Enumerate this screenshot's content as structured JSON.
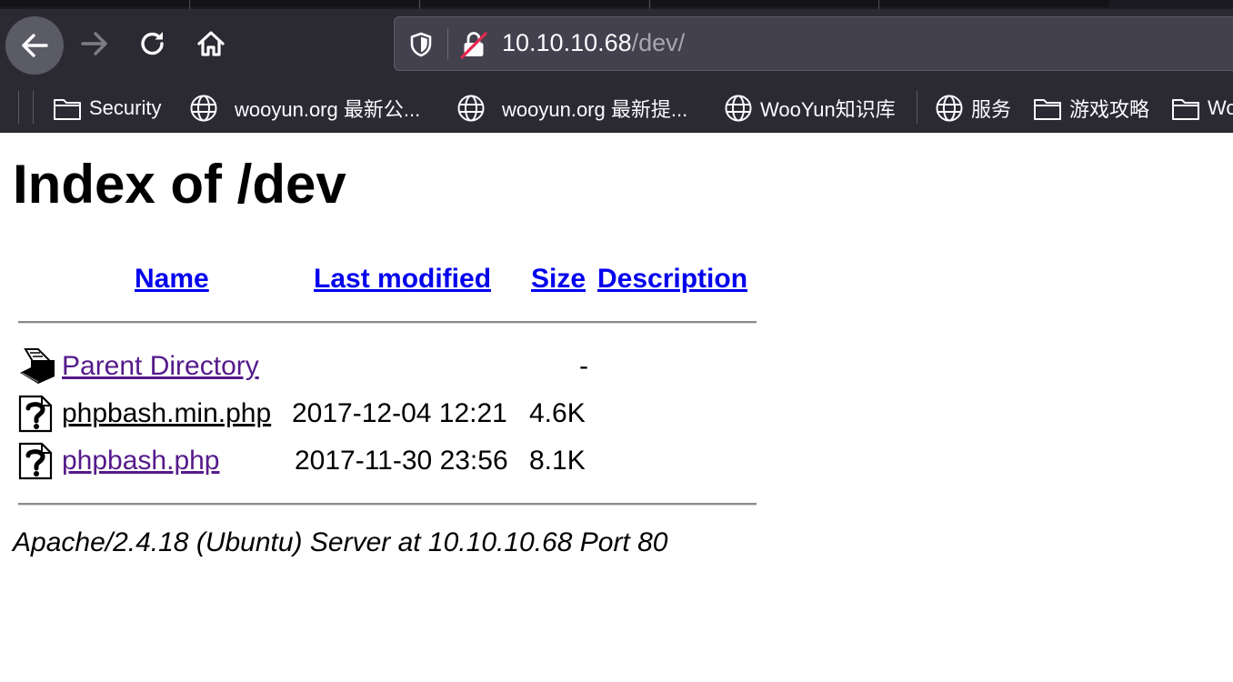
{
  "browser": {
    "url": {
      "host": "10.10.10.68",
      "path": "/dev/"
    },
    "bookmarks": [
      {
        "label": "Security",
        "icon": "folder-icon"
      },
      {
        "label": "wooyun.org 最新公...",
        "icon": "globe-icon"
      },
      {
        "label": "wooyun.org 最新提...",
        "icon": "globe-icon"
      },
      {
        "label": "WooYun知识库",
        "icon": "globe-icon"
      },
      {
        "label": "服务",
        "icon": "globe-icon"
      },
      {
        "label": "游戏攻略",
        "icon": "folder-icon"
      },
      {
        "label": "Wo",
        "icon": "folder-icon"
      }
    ]
  },
  "page": {
    "title": "Index of /dev",
    "columns": {
      "name": "Name",
      "modified": "Last modified",
      "size": "Size",
      "description": "Description"
    },
    "rows": [
      {
        "name": "Parent Directory",
        "modified": "",
        "size": "-",
        "icon": "back-folder-icon"
      },
      {
        "name": "phpbash.min.php",
        "modified": "2017-12-04 12:21",
        "size": "4.6K",
        "icon": "unknown-file-icon"
      },
      {
        "name": "phpbash.php",
        "modified": "2017-11-30 23:56",
        "size": "8.1K",
        "icon": "unknown-file-icon"
      }
    ],
    "footer": "Apache/2.4.18 (Ubuntu) Server at 10.10.10.68 Port 80"
  }
}
